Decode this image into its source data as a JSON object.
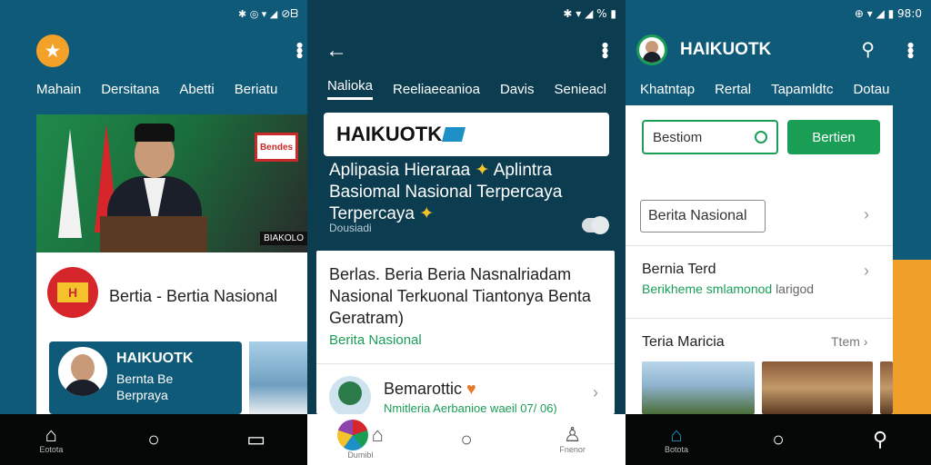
{
  "screens": [
    {
      "status": {
        "left_icons": "✱ ◎ ▾ ◢",
        "right_text": "⊘ᗷ"
      },
      "tabs": [
        "Mahain",
        "Dersitana",
        "Abetti",
        "Beriatu"
      ],
      "hero_banner": "Bendes",
      "hero_caption": "BIAKOLO",
      "brand_logo_text": "H",
      "brand_title": "Bertia - Bertia Nasional",
      "promo": {
        "title": "HAIKUOTK",
        "line1": "Bernta Be",
        "line2": "Berpraya"
      },
      "nav": [
        {
          "icon": "⌂",
          "label": "Eotota"
        },
        {
          "icon": "○",
          "label": ""
        },
        {
          "icon": "▭",
          "label": ""
        }
      ]
    },
    {
      "status": {
        "right_text": "✱ ▾ ◢ % ▮"
      },
      "tabs": [
        "Nalioka",
        "Reeliaeeanioa",
        "Davis",
        "Senieacl"
      ],
      "header_brand": "HAIKUOTK",
      "headline_1": "Aplipasia Hieraraa",
      "headline_2": "Aplintra",
      "headline_3": "Basiomal Nasional Terpercaya",
      "headline_4": "Terpercaya",
      "sub": "Dousiadi",
      "item1_text": "Berlas. Beria Beria Nasnalriadam Nasional Terkuonal Tiantonya Benta Geratram)",
      "item1_category": "Berita Nasional",
      "item2_title": "Bemarottic",
      "item2_meta": "Nmitleria Aerbanioe waeil 07/ 06)",
      "nav": [
        {
          "icon": "⌂",
          "label": "Dumibl"
        },
        {
          "icon": "○",
          "label": ""
        },
        {
          "icon": "♙",
          "label": "Fnenor"
        }
      ]
    },
    {
      "status": {
        "right_text": "⊕ ▾ ◢ ▮ 98:0"
      },
      "app_title": "HAIKUOTK",
      "tabs": [
        "Khatntap",
        "Rertal",
        "Tapamldtc",
        "Dotau"
      ],
      "search_input": "Bestiom",
      "search_button": "Bertien",
      "chip": "Berita Nasional",
      "row2_title": "Bernia Terd",
      "row2_sub_green": "Berikheme smlamonod",
      "row2_sub_gray": "larigod",
      "row3_title": "Teria Maricia",
      "row3_right": "Ttem",
      "nav": [
        {
          "icon": "⌂",
          "label": "Botota"
        },
        {
          "icon": "○",
          "label": ""
        },
        {
          "icon": "⚲",
          "label": ""
        }
      ]
    }
  ]
}
